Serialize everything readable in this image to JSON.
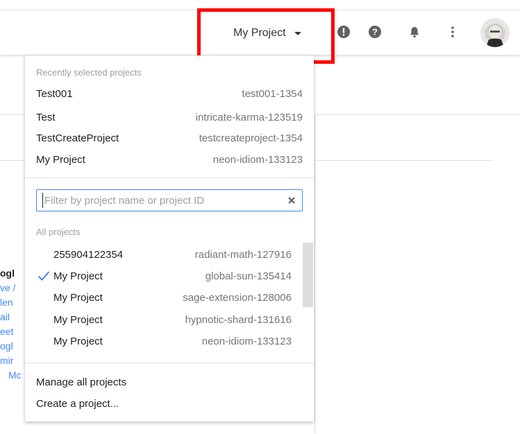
{
  "header": {
    "project_selector_label": "My Project"
  },
  "dropdown": {
    "recent_label": "Recently selected projects",
    "recent": [
      {
        "name": "Test001",
        "id": "test001-1354"
      },
      {
        "name": "Test",
        "id": "intricate-karma-123519"
      },
      {
        "name": "TestCreateProject",
        "id": "testcreateproject-1354"
      },
      {
        "name": "My Project",
        "id": "neon-idiom-133123"
      }
    ],
    "filter_placeholder": "Filter by project name or project ID",
    "filter_value": "",
    "all_label": "All projects",
    "all": [
      {
        "name": "255904122354",
        "id": "radiant-math-127916",
        "selected": false
      },
      {
        "name": "My Project",
        "id": "global-sun-135414",
        "selected": true
      },
      {
        "name": "My Project",
        "id": "sage-extension-128006",
        "selected": false
      },
      {
        "name": "My Project",
        "id": "hypnotic-shard-131616",
        "selected": false
      },
      {
        "name": "My Project",
        "id": "neon-idiom-133123",
        "selected": false
      }
    ],
    "manage_label": "Manage all projects",
    "create_label": "Create a project..."
  },
  "background_snippet": [
    "ogl",
    "ve /",
    "len",
    "ail",
    "eet",
    "ogl",
    "mir",
    "Mc"
  ],
  "colors": {
    "accent": "#4285f4",
    "highlight": "#ff0000",
    "header_icon": "#616161"
  },
  "icons": {
    "alert": "alert-icon",
    "help": "help-icon",
    "notifications": "bell-icon",
    "more": "more-vert-icon",
    "check": "check-icon",
    "clear": "close-icon"
  }
}
